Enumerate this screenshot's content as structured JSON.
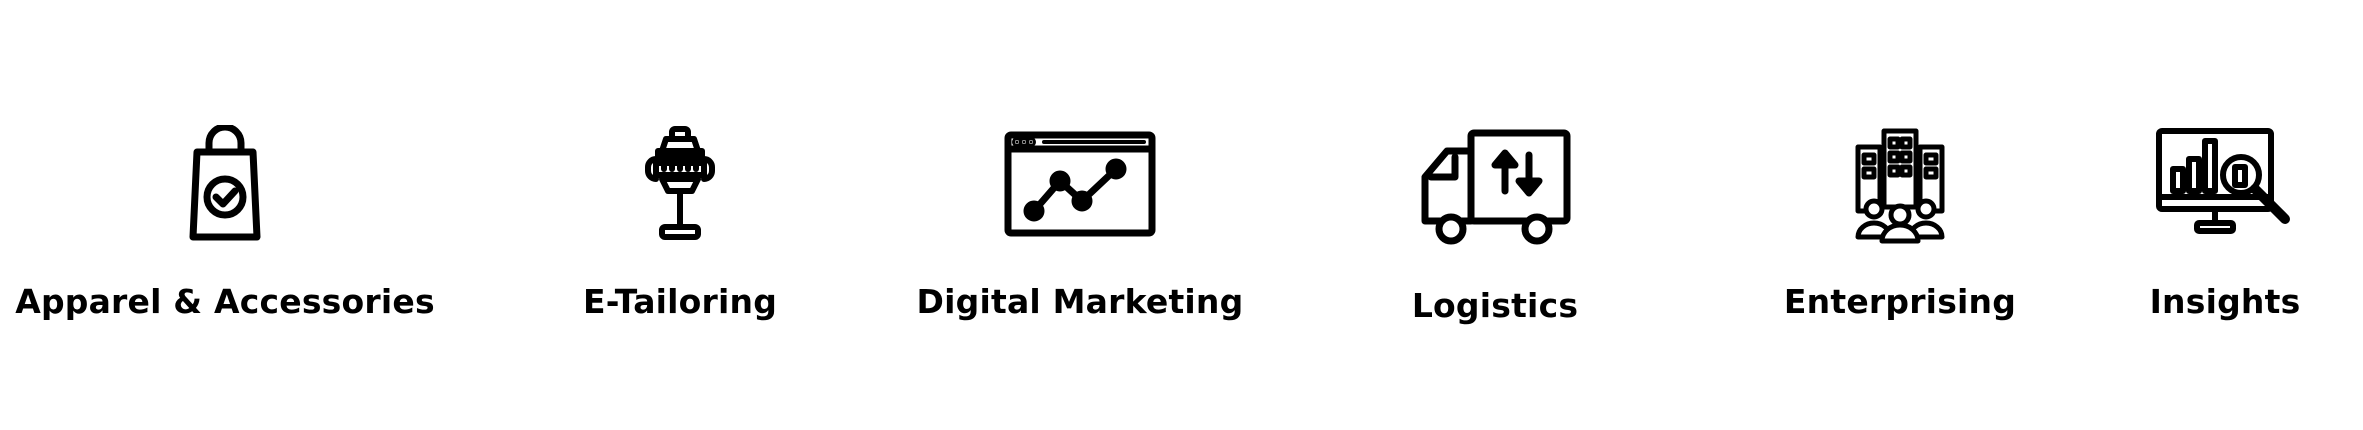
{
  "services": [
    {
      "label": "Apparel & Accessories",
      "icon": "shopping-bag-check-icon"
    },
    {
      "label": "E-Tailoring",
      "icon": "tailor-mannequin-icon"
    },
    {
      "label": "Digital Marketing",
      "icon": "browser-line-chart-icon"
    },
    {
      "label": "Logistics",
      "icon": "delivery-truck-icon"
    },
    {
      "label": "Enterprising",
      "icon": "buildings-people-icon"
    },
    {
      "label": "Insights",
      "icon": "monitor-bar-chart-magnifier-icon"
    }
  ],
  "colors": {
    "background": "#ffffff",
    "foreground": "#000000"
  }
}
